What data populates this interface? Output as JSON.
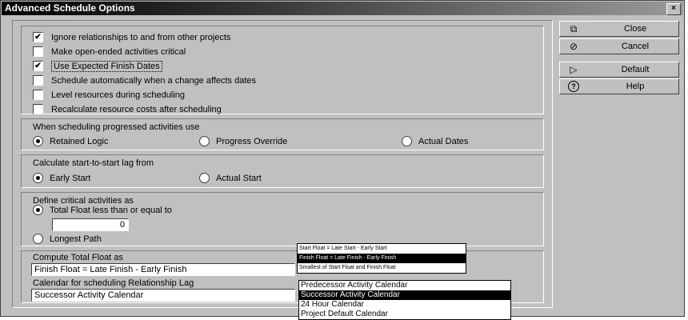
{
  "window": {
    "title": "Advanced Schedule Options",
    "close_glyph": "×"
  },
  "options": [
    {
      "label": "Ignore relationships to and from other projects",
      "checked": true
    },
    {
      "label": "Make open-ended activities critical",
      "checked": false
    },
    {
      "label": "Use Expected Finish Dates",
      "checked": true
    },
    {
      "label": "Schedule automatically when a change affects dates",
      "checked": false
    },
    {
      "label": "Level resources during scheduling",
      "checked": false
    },
    {
      "label": "Recalculate resource costs after scheduling",
      "checked": false
    }
  ],
  "progressed": {
    "heading": "When scheduling progressed activities use",
    "choices": [
      "Retained Logic",
      "Progress Override",
      "Actual Dates"
    ],
    "selected": "Retained Logic"
  },
  "start_lag": {
    "heading": "Calculate start-to-start lag from",
    "choices": [
      "Early Start",
      "Actual Start"
    ],
    "selected": "Early Start"
  },
  "critical": {
    "heading": "Define critical activities as",
    "total_float_label": "Total Float less than or equal to",
    "total_float_value": "0",
    "longest_path_label": "Longest Path",
    "selected": "Total Float"
  },
  "total_float": {
    "heading": "Compute Total Float as",
    "value": "Finish Float = Late Finish - Early Finish",
    "options": [
      "Start Float = Late Start - Early Start",
      "Finish Float = Late Finish - Early Finish",
      "Smallest of Start Float and Finish Float"
    ],
    "selected_index": 1
  },
  "lag_calendar": {
    "heading": "Calendar for scheduling Relationship Lag",
    "value": "Successor Activity Calendar",
    "options": [
      "Predecessor Activity Calendar",
      "Successor Activity Calendar",
      "24 Hour Calendar",
      "Project Default Calendar"
    ],
    "selected_index": 1
  },
  "buttons": [
    {
      "label": "Close",
      "icon": "close-window-icon",
      "glyph": "⧉"
    },
    {
      "label": "Cancel",
      "icon": "cancel-icon",
      "glyph": "⊘"
    },
    {
      "label": "Default",
      "icon": "default-arrow-icon",
      "glyph": "▷"
    },
    {
      "label": "Help",
      "icon": "help-icon",
      "glyph": "?"
    }
  ]
}
